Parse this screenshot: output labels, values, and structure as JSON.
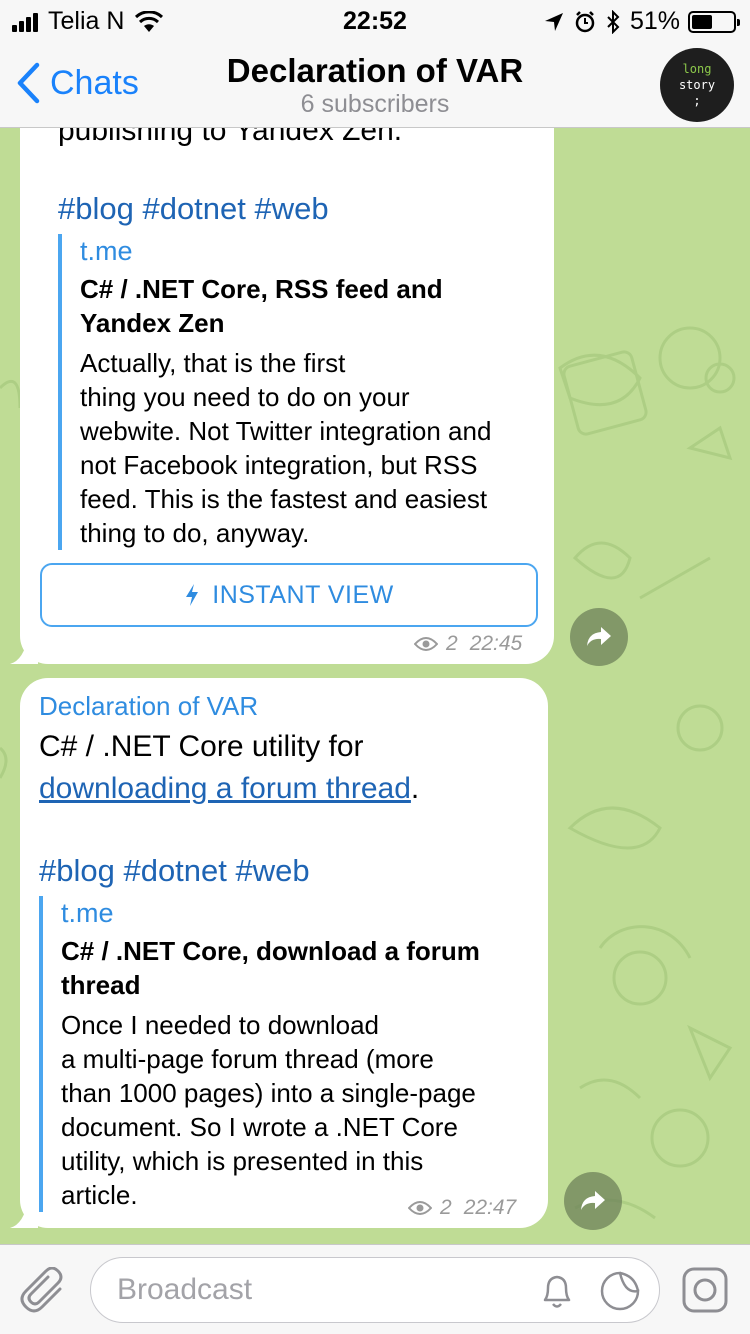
{
  "status_bar": {
    "carrier": "Telia N",
    "time": "22:52",
    "battery_percent": "51%",
    "battery_level": 0.51
  },
  "nav": {
    "back_label": "Chats",
    "title": "Declaration of VAR",
    "subtitle": "6 subscribers",
    "avatar_text_line1": "long",
    "avatar_text_line2": "story",
    "avatar_text_line3": ";"
  },
  "messages": [
    {
      "partial_text": "publishing to Yandex Zen.",
      "hashtags": "#blog #dotnet #web",
      "preview": {
        "site": "t.me",
        "title_line1": "C# / .NET Core, RSS feed and",
        "title_line2": "Yandex Zen",
        "desc_lines": [
          "Actually, that is the first",
          "thing you need to do on your",
          "webwite. Not Twitter integration and",
          "not Facebook integration, but RSS",
          "feed. This is the fastest and easiest",
          "thing to do, anyway."
        ]
      },
      "instant_view_label": "INSTANT VIEW",
      "views": "2",
      "time": "22:45"
    },
    {
      "sender": "Declaration of VAR",
      "text_line1": "C# / .NET Core utility for",
      "link_text": "downloading a forum thread",
      "link_suffix": ".",
      "hashtags": "#blog #dotnet #web",
      "preview": {
        "site": "t.me",
        "title_line1": "C# / .NET Core, download a forum",
        "title_line2": "thread",
        "desc_lines": [
          "Once I needed to download",
          "a multi-page forum thread (more",
          "than 1000 pages) into a single-page",
          "document. So I wrote a .NET Core",
          "utility, which is presented in this",
          "article."
        ]
      },
      "views": "2",
      "time": "22:47"
    }
  ],
  "input": {
    "placeholder": "Broadcast"
  }
}
